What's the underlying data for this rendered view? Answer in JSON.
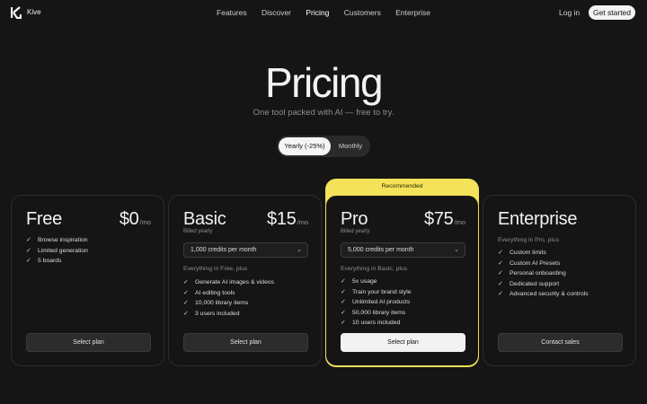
{
  "nav": {
    "brand": "Kive",
    "links": [
      "Features",
      "Discover",
      "Pricing",
      "Customers",
      "Enterprise"
    ],
    "active_link": "Pricing",
    "login": "Log in",
    "cta": "Get started"
  },
  "hero": {
    "title": "Pricing",
    "subtitle": "One tool packed with AI — free to try."
  },
  "billing_toggle": {
    "yearly": "Yearly (-25%)",
    "monthly": "Monthly",
    "selected": "Yearly (-25%)"
  },
  "plans": [
    {
      "name": "Free",
      "price": "$0",
      "per": "/mo",
      "features": [
        "Browse inspiration",
        "Limited generation",
        "5 boards"
      ],
      "button": "Select plan"
    },
    {
      "name": "Basic",
      "price": "$15",
      "per": "/mo",
      "billed": "Billed yearly",
      "credits": "1,000 credits per month",
      "intro": "Everything in Free, plus",
      "features": [
        "Generate AI images & videos",
        "AI editing tools",
        "10,000 library items",
        "3 users included"
      ],
      "button": "Select plan"
    },
    {
      "name": "Pro",
      "badge": "Recommended",
      "price": "$75",
      "per": "/mo",
      "billed": "Billed yearly",
      "credits": "5,000 credits per month",
      "intro": "Everything in Basic, plus",
      "features": [
        "5x usage",
        "Train your brand style",
        "Unlimited AI products",
        "50,000 library items",
        "10 users included"
      ],
      "button": "Select plan"
    },
    {
      "name": "Enterprise",
      "intro": "Everything in Pro, plus",
      "features": [
        "Custom limits",
        "Custom AI Presets",
        "Personal onboarding",
        "Dedicated support",
        "Advanced security & controls"
      ],
      "button": "Contact sales"
    }
  ],
  "icons": {
    "logo": "kive-logo-icon",
    "check": "check-icon",
    "dropdown": "chevron-down-icon"
  },
  "colors": {
    "background": "#151515",
    "recommended": "#f4e35a",
    "primary_button": "#f2f2f2"
  }
}
